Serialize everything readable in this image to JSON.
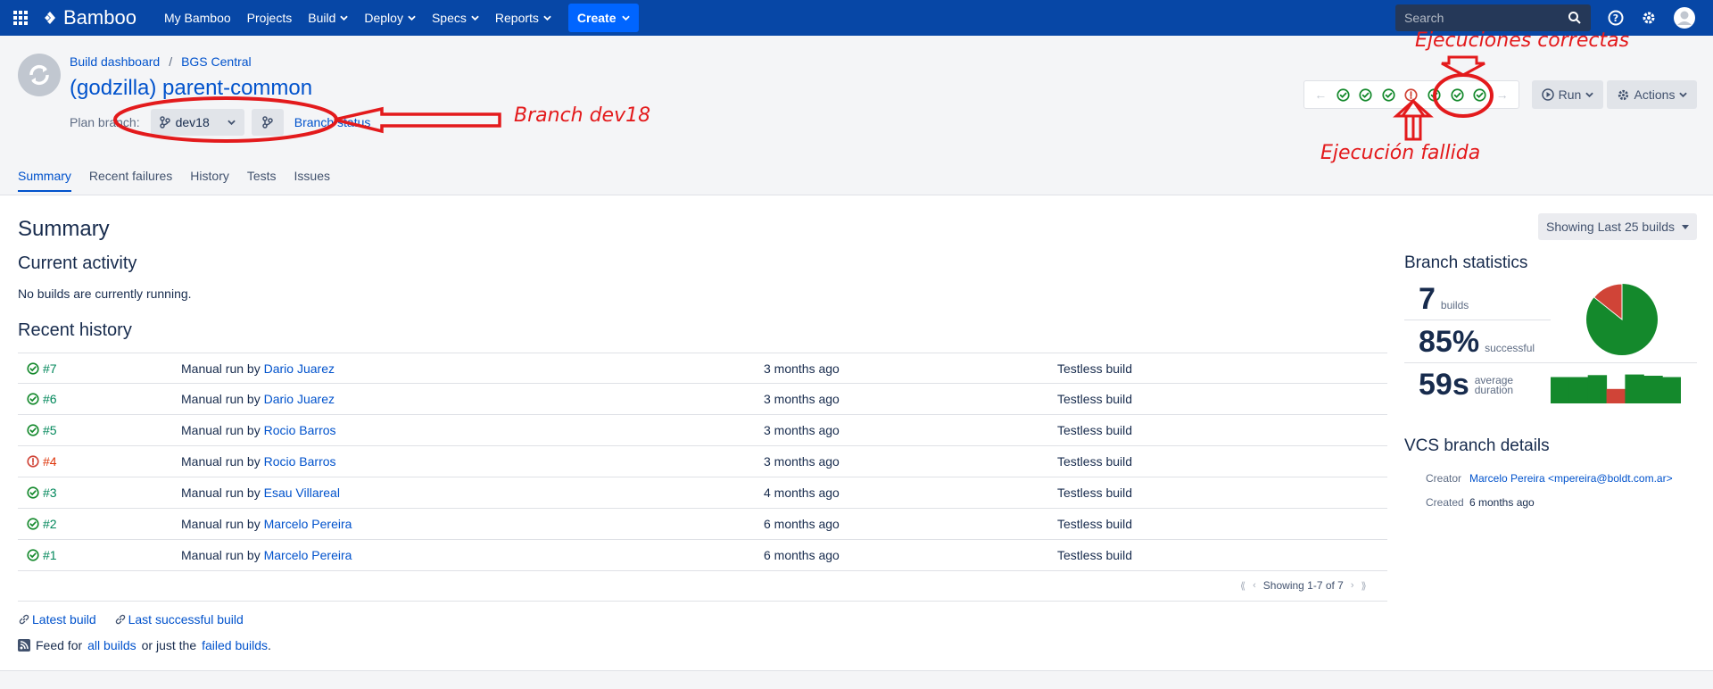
{
  "nav": {
    "logo": "Bamboo",
    "items": [
      "My Bamboo",
      "Projects",
      "Build",
      "Deploy",
      "Specs",
      "Reports"
    ],
    "create": "Create",
    "search_placeholder": "Search"
  },
  "header": {
    "breadcrumbs": [
      "Build dashboard",
      "BGS Central"
    ],
    "breadcrumb_sep": "/",
    "title": "(godzilla) parent-common",
    "plan_branch_label": "Plan branch:",
    "branch_value": "dev18",
    "branch_status": "Branch status",
    "run": "Run",
    "actions": "Actions"
  },
  "build_strip": [
    "success",
    "success",
    "success",
    "failed",
    "success",
    "success",
    "success"
  ],
  "tabs": [
    "Summary",
    "Recent failures",
    "History",
    "Tests",
    "Issues"
  ],
  "summary": {
    "title": "Summary",
    "showing": "Showing Last 25 builds",
    "current_activity": "Current activity",
    "no_builds": "No builds are currently running.",
    "recent_history": "Recent history",
    "manual_run_by": "Manual run by",
    "rows": [
      {
        "num": "#7",
        "status": "success",
        "user": "Dario Juarez",
        "when": "3 months ago",
        "tests": "Testless build"
      },
      {
        "num": "#6",
        "status": "success",
        "user": "Dario Juarez",
        "when": "3 months ago",
        "tests": "Testless build"
      },
      {
        "num": "#5",
        "status": "success",
        "user": "Rocio Barros",
        "when": "3 months ago",
        "tests": "Testless build"
      },
      {
        "num": "#4",
        "status": "failed",
        "user": "Rocio Barros",
        "when": "3 months ago",
        "tests": "Testless build"
      },
      {
        "num": "#3",
        "status": "success",
        "user": "Esau Villareal",
        "when": "4 months ago",
        "tests": "Testless build"
      },
      {
        "num": "#2",
        "status": "success",
        "user": "Marcelo Pereira",
        "when": "6 months ago",
        "tests": "Testless build"
      },
      {
        "num": "#1",
        "status": "success",
        "user": "Marcelo Pereira",
        "when": "6 months ago",
        "tests": "Testless build"
      }
    ],
    "pager": "Showing 1-7 of 7",
    "latest_build": "Latest build",
    "last_successful_build": "Last successful build",
    "feed_prefix": "Feed for",
    "all_builds": "all builds",
    "feed_middle": "or just the",
    "failed_builds": "failed builds",
    "feed_end": "."
  },
  "stats": {
    "title": "Branch statistics",
    "builds_value": "7",
    "builds_label": "builds",
    "success_value": "85%",
    "success_label": "successful",
    "duration_value": "59s",
    "duration_label_1": "average",
    "duration_label_2": "duration",
    "pie_success_fraction": 0.857,
    "bar_levels": [
      0.82,
      0.82,
      0.88,
      0.45,
      0.9,
      0.86,
      0.82
    ],
    "bar_status": [
      "success",
      "success",
      "success",
      "failed",
      "success",
      "success",
      "success"
    ]
  },
  "vcs": {
    "title": "VCS branch details",
    "creator_label": "Creator",
    "creator_value": "Marcelo Pereira <mpereira@boldt.com.ar>",
    "created_label": "Created",
    "created_value": "6 months ago"
  },
  "annotations": {
    "branch": "Branch dev18",
    "correct": "Ejecuciones correctas",
    "failed": "Ejecución fallida"
  },
  "colors": {
    "nav": "#0747a6",
    "success": "#14892c",
    "failed": "#d04437",
    "annotation": "#e31a1c"
  }
}
